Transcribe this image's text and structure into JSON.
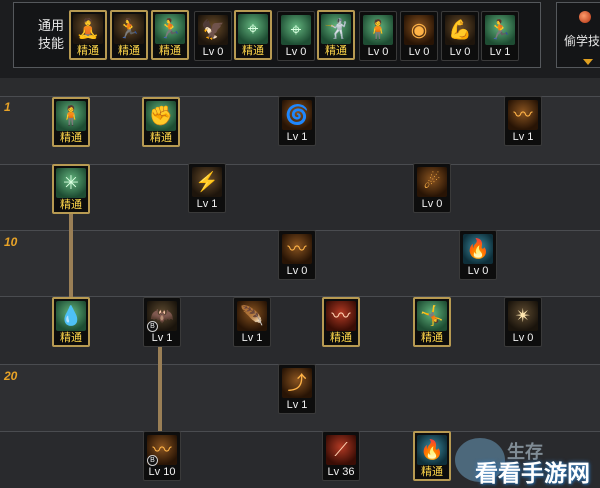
{
  "common": {
    "label": "通用\n技能",
    "skills": [
      {
        "icon": "meditate-icon",
        "glyph": "🧘",
        "tone": "y",
        "label": "精通",
        "mastery": true
      },
      {
        "icon": "crouch-icon",
        "glyph": "🏃",
        "tone": "y",
        "label": "精通",
        "mastery": true
      },
      {
        "icon": "dash-icon",
        "glyph": "🏃",
        "tone": "g",
        "label": "精通",
        "mastery": true
      },
      {
        "icon": "wings-icon",
        "glyph": "🦅",
        "tone": "y",
        "label": "Lv 0",
        "mastery": false
      },
      {
        "icon": "crosshair-icon",
        "glyph": "⌖",
        "tone": "g",
        "label": "精通",
        "mastery": true
      },
      {
        "icon": "target-icon",
        "glyph": "⌖",
        "tone": "g",
        "label": "Lv 0",
        "mastery": false
      },
      {
        "icon": "fighter-icon",
        "glyph": "🤺",
        "tone": "g",
        "label": "精通",
        "mastery": true
      },
      {
        "icon": "figure-icon",
        "glyph": "🧍",
        "tone": "g",
        "label": "Lv 0",
        "mastery": false
      },
      {
        "icon": "spiral-icon",
        "glyph": "◉",
        "tone": "o",
        "label": "Lv 0",
        "mastery": false
      },
      {
        "icon": "muscle-icon",
        "glyph": "💪",
        "tone": "y",
        "label": "Lv 0",
        "mastery": false
      },
      {
        "icon": "runner-icon",
        "glyph": "🏃",
        "tone": "g",
        "label": "Lv 1",
        "mastery": false
      }
    ]
  },
  "steal": {
    "label": "偷学技"
  },
  "levels": {
    "l1": "1",
    "l10": "10",
    "l20": "20"
  },
  "tree": [
    {
      "icon": "stance-icon",
      "glyph": "🧍",
      "tone": "g",
      "label": "精通",
      "mastery": true
    },
    {
      "icon": "explosion-fist-icon",
      "glyph": "✊",
      "tone": "g",
      "label": "精通",
      "mastery": true
    },
    {
      "icon": "whirl-icon",
      "glyph": "🌀",
      "tone": "o",
      "label": "Lv 1",
      "mastery": false
    },
    {
      "icon": "wind-slash-icon",
      "glyph": "〰",
      "tone": "o",
      "label": "Lv 1",
      "mastery": false
    },
    {
      "icon": "burst-icon",
      "glyph": "✳",
      "tone": "g",
      "label": "精通",
      "mastery": true
    },
    {
      "icon": "claw-icon",
      "glyph": "⚡",
      "tone": "y",
      "label": "Lv 1",
      "mastery": false
    },
    {
      "icon": "orb-icon",
      "glyph": "☄",
      "tone": "o",
      "label": "Lv 0",
      "mastery": false
    },
    {
      "icon": "sandstorm-icon",
      "glyph": "〰",
      "tone": "o",
      "label": "Lv 0",
      "mastery": false
    },
    {
      "icon": "blue-flame-icon",
      "glyph": "🔥",
      "tone": "c",
      "label": "Lv 0",
      "mastery": false
    },
    {
      "icon": "drop-icon",
      "glyph": "💧",
      "tone": "g",
      "label": "精通",
      "mastery": true
    },
    {
      "icon": "bat-icon",
      "glyph": "🦇",
      "tone": "d",
      "label": "Lv 1",
      "mastery": false,
      "badge": "B"
    },
    {
      "icon": "wing-icon",
      "glyph": "🪶",
      "tone": "o",
      "label": "Lv 1",
      "mastery": false
    },
    {
      "icon": "wave-icon",
      "glyph": "〰",
      "tone": "r",
      "label": "精通",
      "mastery": true
    },
    {
      "icon": "leap-icon",
      "glyph": "🤸",
      "tone": "g",
      "label": "精通",
      "mastery": true
    },
    {
      "icon": "shatter-icon",
      "glyph": "✴",
      "tone": "d",
      "label": "Lv 0",
      "mastery": false
    },
    {
      "icon": "spear-icon",
      "glyph": "⤴",
      "tone": "o",
      "label": "Lv 1",
      "mastery": false
    },
    {
      "icon": "gust-icon",
      "glyph": "〰",
      "tone": "o",
      "label": "Lv 10",
      "mastery": false,
      "badge": "B"
    },
    {
      "icon": "slash-icon",
      "glyph": "⟋",
      "tone": "r",
      "label": "Lv 36",
      "mastery": false
    },
    {
      "icon": "aura-icon",
      "glyph": "🔥",
      "tone": "c",
      "label": "精通",
      "mastery": true
    }
  ],
  "watermark": {
    "text": "看看手游网",
    "sub": "生存"
  }
}
